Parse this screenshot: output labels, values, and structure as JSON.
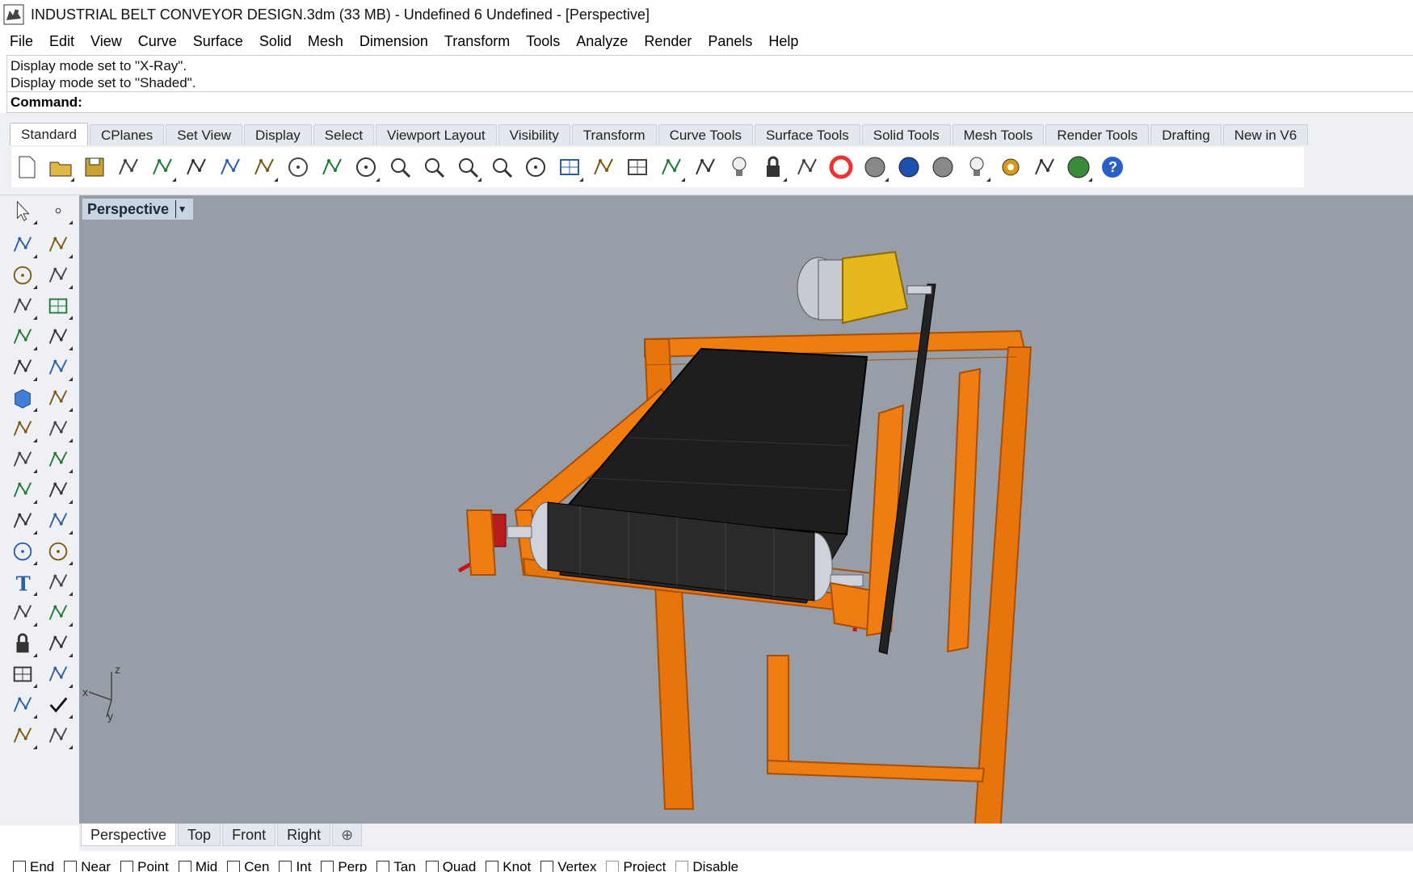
{
  "window": {
    "title": "INDUSTRIAL BELT CONVEYOR DESIGN.3dm (33 MB) - Undefined 6 Undefined - [Perspective]",
    "app_icon": "rhino-icon"
  },
  "menu": [
    "File",
    "Edit",
    "View",
    "Curve",
    "Surface",
    "Solid",
    "Mesh",
    "Dimension",
    "Transform",
    "Tools",
    "Analyze",
    "Render",
    "Panels",
    "Help"
  ],
  "history": [
    "Display mode set to \"X-Ray\".",
    "Display mode set to \"Shaded\"."
  ],
  "command": {
    "label": "Command:",
    "value": ""
  },
  "toolbar_tabs": [
    "Standard",
    "CPlanes",
    "Set View",
    "Display",
    "Select",
    "Viewport Layout",
    "Visibility",
    "Transform",
    "Curve Tools",
    "Surface Tools",
    "Solid Tools",
    "Mesh Tools",
    "Render Tools",
    "Drafting",
    "New in V6"
  ],
  "active_toolbar_tab": "Standard",
  "standard_tools": [
    "new-file-icon",
    "open-file-icon",
    "save-icon",
    "print-icon",
    "import-icon",
    "cut-icon",
    "copy-icon",
    "paste-icon",
    "undo-icon",
    "pan-hand-icon",
    "rotate-view-icon",
    "zoom-icon",
    "zoom-window-icon",
    "zoom-extents-icon",
    "zoom-selected-icon",
    "undo-view-icon",
    "four-viewports-icon",
    "named-views-car-icon",
    "grid-options-icon",
    "cplane-icon",
    "object-snap-icon",
    "lights-icon",
    "lock-icon",
    "layer-icon",
    "color-wheel-icon",
    "shaded-sphere-icon",
    "render-sphere-icon",
    "material-sphere-icon",
    "spotlight-icon",
    "options-gear-icon",
    "dimension-icon",
    "grasshopper-icon",
    "help-icon"
  ],
  "sidebar_tools": [
    [
      "select-arrow-icon",
      "point-icon"
    ],
    [
      "polyline-icon",
      "curve-icon"
    ],
    [
      "circle-icon",
      "ellipse-icon"
    ],
    [
      "arc-icon",
      "rectangle-icon"
    ],
    [
      "polygon-icon",
      "fillet-curve-icon"
    ],
    [
      "surface-corner-icon",
      "revolve-icon"
    ],
    [
      "box-solid-icon",
      "boolean-union-icon"
    ],
    [
      "cylinder-icon",
      "surface-network-icon"
    ],
    [
      "explode-icon",
      "trim-icon"
    ],
    [
      "split-icon",
      "join-icon"
    ],
    [
      "group-icon",
      "ungroup-icon"
    ],
    [
      "rotate-icon",
      "rotate-3d-icon"
    ],
    [
      "text-icon",
      "scale-icon"
    ],
    [
      "array-icon",
      "mirror-icon"
    ],
    [
      "block-icon",
      "dimension-linear-icon"
    ],
    [
      "array-grid-icon",
      "align-icon"
    ],
    [
      "extrude-icon",
      "check-icon"
    ],
    [
      "mesh-icon",
      "analyze-icon"
    ]
  ],
  "viewport": {
    "name": "Perspective",
    "dropdown_icon": "chevron-down-icon",
    "axes": {
      "x": "x",
      "y": "y",
      "z": "z"
    }
  },
  "view_tabs": [
    "Perspective",
    "Top",
    "Front",
    "Right"
  ],
  "active_view_tab": "Perspective",
  "add_view_tab": "⊕",
  "osnaps": [
    {
      "label": "End",
      "checked": false
    },
    {
      "label": "Near",
      "checked": false
    },
    {
      "label": "Point",
      "checked": false
    },
    {
      "label": "Mid",
      "checked": false
    },
    {
      "label": "Cen",
      "checked": false
    },
    {
      "label": "Int",
      "checked": false
    },
    {
      "label": "Perp",
      "checked": false
    },
    {
      "label": "Tan",
      "checked": false
    },
    {
      "label": "Quad",
      "checked": false
    },
    {
      "label": "Knot",
      "checked": false
    },
    {
      "label": "Vertex",
      "checked": false
    },
    {
      "label": "Project",
      "checked": false
    },
    {
      "label": "Disable",
      "checked": false
    }
  ],
  "colors": {
    "viewport_bg": "#979ea7",
    "frame_orange": "#f07d12",
    "belt_black": "#1e1e1e",
    "motor_yellow": "#e6b71c",
    "roller_silver": "#cfd2db"
  }
}
